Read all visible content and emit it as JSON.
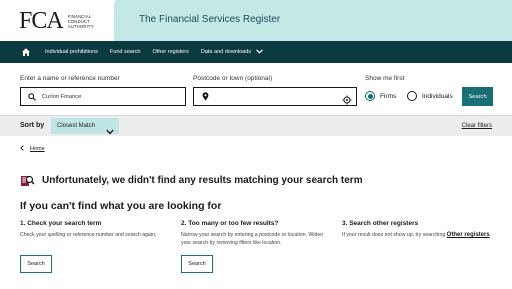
{
  "header": {
    "logo_mark": "FCA",
    "logo_lines": [
      "FINANCIAL",
      "CONDUCT",
      "AUTHORITY"
    ],
    "title": "The Financial Services Register"
  },
  "nav": {
    "items": [
      {
        "label": "Individual prohibitions"
      },
      {
        "label": "Fund search"
      },
      {
        "label": "Other registers"
      },
      {
        "label": "Data and downloads"
      }
    ]
  },
  "search": {
    "name_label": "Enter a name or reference number",
    "name_value": "Curlon Finance",
    "postcode_label": "Postcode or town (optional)",
    "postcode_value": "",
    "show_label": "Show me first",
    "radio_firms": "Firms",
    "radio_individuals": "Individuals",
    "selected": "Firms",
    "button": "Search"
  },
  "sort": {
    "label": "Sort by",
    "selected": "Closest Match",
    "clear": "Clear filters"
  },
  "breadcrumb": {
    "home": "Home"
  },
  "results": {
    "message": "Unfortunately, we didn't find any results matching your search term",
    "help_heading": "If you can't find what you are looking for",
    "columns": [
      {
        "title": "1. Check your search term",
        "text": "Check your spelling or reference number and search again.",
        "button": "Search"
      },
      {
        "title": "2. Too many or too few results?",
        "text": "Narrow your search by entering a postcode or location. Widen your search by removing filters like location.",
        "button": "Search"
      },
      {
        "title": "3. Search other registers",
        "text": "If your result does not show up, try searching ",
        "link": "Other registers",
        "text_after": "."
      }
    ]
  },
  "colors": {
    "header_band": "#c2e9e6",
    "nav_bg": "#0b3a41",
    "primary": "#1a6e75",
    "sort_select": "#bfe6e3",
    "icon_accent": "#8a1d3a"
  },
  "icons": {
    "home": "home-icon",
    "search": "magnifier-icon",
    "location": "map-pin-icon",
    "locate": "crosshair-icon",
    "chevron": "chevron-down-icon",
    "noresults": "no-results-icon"
  }
}
